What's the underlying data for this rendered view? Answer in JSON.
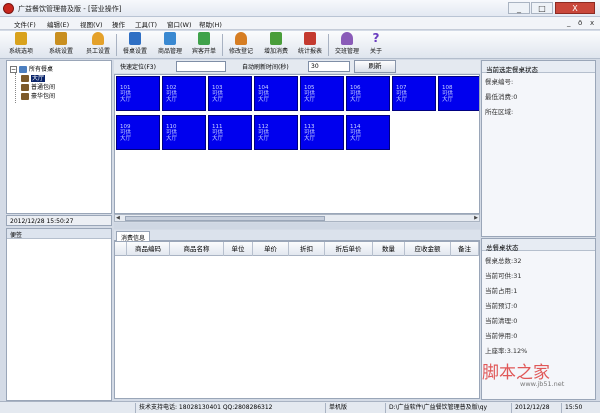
{
  "window": {
    "title": "广益餐饮管理普及版 - [营业操作]",
    "controls": [
      "_",
      "□",
      "X"
    ]
  },
  "menubar": {
    "items": [
      "文件(F)",
      "编辑(E)",
      "视图(V)",
      "操作",
      "工具(T)",
      "窗口(W)",
      "帮助(H)"
    ],
    "mdi_controls": [
      "_",
      "ō",
      "x"
    ]
  },
  "toolbar": {
    "items": [
      {
        "label": "系统选项",
        "icon": "key-icon",
        "color": "#d9a21c"
      },
      {
        "label": "系统设置",
        "icon": "wrench-icon",
        "color": "#c98f1f"
      },
      {
        "label": "员工设置",
        "icon": "person-icon",
        "color": "#e4a12a"
      },
      {
        "label": "餐桌设置",
        "icon": "table-icon",
        "color": "#2e6fc4"
      },
      {
        "label": "商品管理",
        "icon": "goods-icon",
        "color": "#3a89d1"
      },
      {
        "label": "宾客开单",
        "icon": "order-icon",
        "color": "#3fa24a"
      },
      {
        "label": "修改登记",
        "icon": "edit-person-icon",
        "color": "#d67d22"
      },
      {
        "label": "增加消费",
        "icon": "add-consume-icon",
        "color": "#4a9e3a"
      },
      {
        "label": "统计报表",
        "icon": "chart-icon",
        "color": "#c43a2f"
      },
      {
        "label": "交班管理",
        "icon": "shift-icon",
        "color": "#8a5bb8"
      },
      {
        "label": "关于",
        "icon": "question-icon",
        "color": "#6a3dbf"
      }
    ]
  },
  "tree": {
    "root": "所有餐桌",
    "children": [
      "大厅",
      "普通包间",
      "豪华包间"
    ],
    "selected": "大厅"
  },
  "datetime": "2012/12/28  15:50:27",
  "notes": {
    "title": "便签"
  },
  "locate": {
    "label": "快速定位(F3)",
    "value": "",
    "refresh_label": "自动刷新时间(秒)",
    "refresh_value": "30",
    "refresh_button": "刷新"
  },
  "tables": [
    {
      "no": "101",
      "status": "可供",
      "area": "大厅"
    },
    {
      "no": "102",
      "status": "可供",
      "area": "大厅"
    },
    {
      "no": "103",
      "status": "可供",
      "area": "大厅"
    },
    {
      "no": "104",
      "status": "可供",
      "area": "大厅"
    },
    {
      "no": "105",
      "status": "可供",
      "area": "大厅"
    },
    {
      "no": "106",
      "status": "可供",
      "area": "大厅"
    },
    {
      "no": "107",
      "status": "可供",
      "area": "大厅"
    },
    {
      "no": "108",
      "status": "可供",
      "area": "大厅"
    },
    {
      "no": "109",
      "status": "可供",
      "area": "大厅"
    },
    {
      "no": "110",
      "status": "可供",
      "area": "大厅"
    },
    {
      "no": "111",
      "status": "可供",
      "area": "大厅"
    },
    {
      "no": "112",
      "status": "可供",
      "area": "大厅"
    },
    {
      "no": "113",
      "status": "可供",
      "area": "大厅"
    },
    {
      "no": "114",
      "status": "可供",
      "area": "大厅"
    }
  ],
  "consume": {
    "tab": "消费信息",
    "columns": [
      "商品编码",
      "商品名称",
      "单位",
      "单价",
      "折扣",
      "折后单价",
      "数量",
      "应收金额",
      "备注"
    ]
  },
  "current_table": {
    "title": "当前选定餐桌状态",
    "lines": [
      "餐桌编号:",
      "最低消费:0",
      "所在区域:"
    ]
  },
  "overall": {
    "title": "总餐桌状态",
    "lines": [
      "餐桌总数:32",
      "当前可供:31",
      "当前占用:1",
      "当前预订:0",
      "当前清理:0",
      "当前停用:0",
      "上座率:3.12%"
    ]
  },
  "statusbar": {
    "cells": [
      "技术支持电话: 18028130401 QQ:2808286312",
      "单机版",
      "D:\\广益软件\\广益餐饮管理普及版\\qy",
      "2012/12/28",
      "15:50"
    ]
  },
  "watermark": {
    "text": "脚本之家",
    "url": "www.jb51.net"
  }
}
